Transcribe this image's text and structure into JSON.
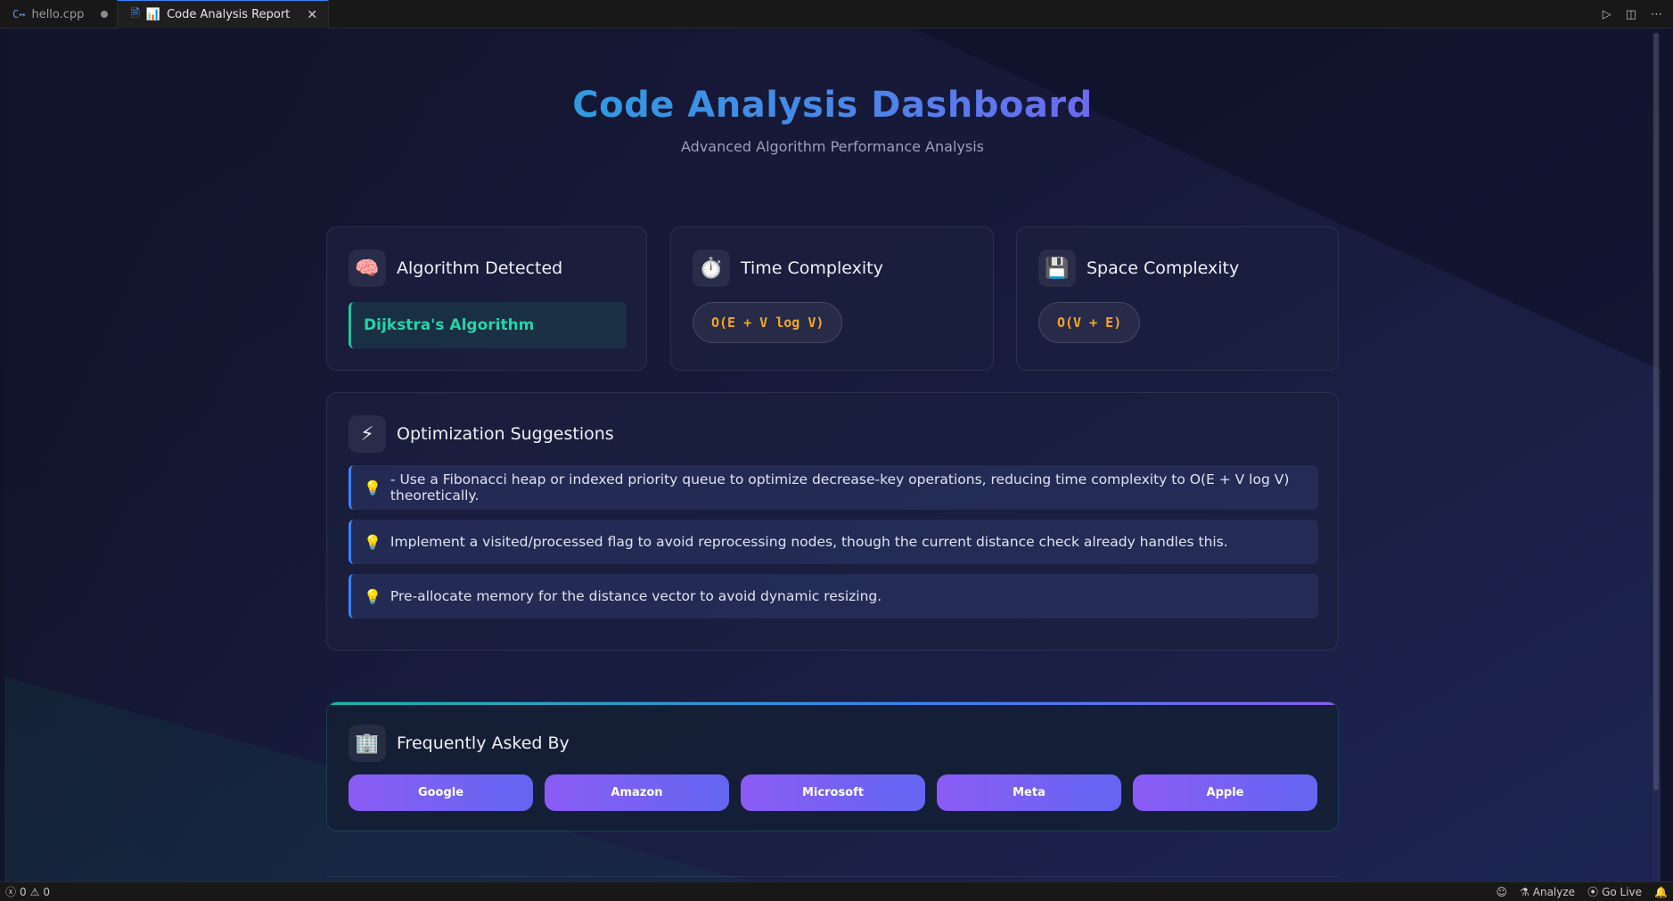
{
  "tabs": [
    {
      "label": "hello.cpp",
      "icon": "cpp-file-icon",
      "modified": true
    },
    {
      "label": "Code Analysis Report",
      "icon": "report-icon",
      "active": true
    }
  ],
  "header": {
    "title": "Code Analysis Dashboard",
    "subtitle": "Advanced Algorithm Performance Analysis"
  },
  "cards": {
    "algorithm": {
      "title": "Algorithm Detected",
      "icon": "brain-icon",
      "value": "Dijkstra's Algorithm"
    },
    "time": {
      "title": "Time Complexity",
      "icon": "stopwatch-icon",
      "value": "O(E + V log V)"
    },
    "space": {
      "title": "Space Complexity",
      "icon": "floppy-disk-icon",
      "value": "O(V + E)"
    }
  },
  "optimization": {
    "title": "Optimization Suggestions",
    "icon": "lightning-icon",
    "items": [
      "- Use a Fibonacci heap or indexed priority queue to optimize decrease-key operations, reducing time complexity to O(E + V log V) theoretically.",
      "Implement a visited/processed flag to avoid reprocessing nodes, though the current distance check already handles this.",
      "Pre-allocate memory for the distance vector to avoid dynamic resizing."
    ]
  },
  "faq": {
    "title": "Frequently Asked By",
    "icon": "office-building-icon",
    "companies": [
      "Google",
      "Amazon",
      "Microsoft",
      "Meta",
      "Apple"
    ]
  },
  "statusbar": {
    "errors": "0",
    "warnings": "0",
    "analyze_label": "Analyze",
    "golive_label": "Go Live"
  },
  "colors": {
    "accent_blue": "#3b82f6",
    "accent_green": "#22c3a0",
    "complexity_orange": "#f5a623",
    "company_purple": "#8b5cf6"
  }
}
